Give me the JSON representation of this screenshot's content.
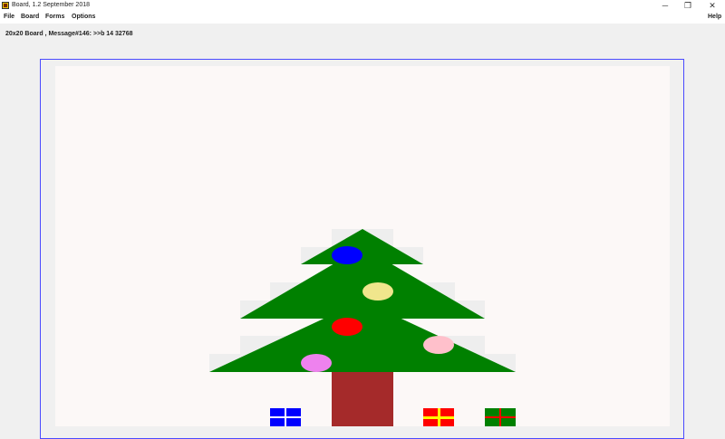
{
  "window": {
    "title": "Board, 1.2 September 2018",
    "buttons": {
      "minimize_icon": "─",
      "restore_icon": "❐",
      "close_icon": "✕"
    }
  },
  "menu": {
    "file": "File",
    "board": "Board",
    "forms": "Forms",
    "options": "Options",
    "help": "Help"
  },
  "status": {
    "text": "20x20 Board , Message#146: >>b 14 32768"
  },
  "colors": {
    "board_background": "#fcf8f7",
    "cell_shade": "#eeeeee",
    "tree": "#008000",
    "trunk": "#a52a2a",
    "frame_border": "#4a4aff"
  },
  "scene": {
    "ornaments": [
      {
        "name": "blue-ornament",
        "color": "#0000ff"
      },
      {
        "name": "khaki-ornament",
        "color": "#f0e68c"
      },
      {
        "name": "red-ornament",
        "color": "#ff0000"
      },
      {
        "name": "pink-ornament",
        "color": "#ffc0cb"
      },
      {
        "name": "violet-ornament",
        "color": "#ee82ee"
      }
    ],
    "presents": [
      {
        "name": "blue-present",
        "box": "#0000ff",
        "ribbon": "#ffffff"
      },
      {
        "name": "red-present",
        "box": "#ff0000",
        "ribbon": "#ffff00"
      },
      {
        "name": "green-present",
        "box": "#008000",
        "ribbon": "#ff0000"
      }
    ]
  }
}
